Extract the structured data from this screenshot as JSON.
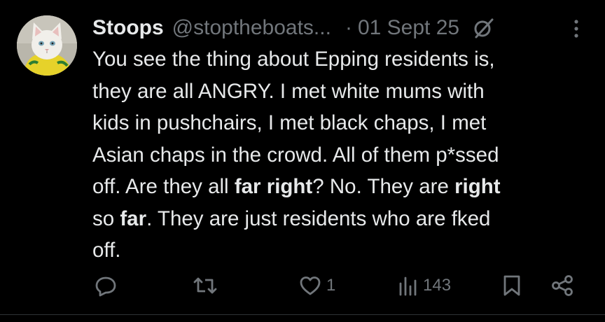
{
  "author": {
    "display_name": "Stoops",
    "handle": "@stoptheboats...",
    "separator": "·",
    "date": "01 Sept 25",
    "avatar_icon": "white-cat-avatar",
    "badge_icon": "grok-icon"
  },
  "tweet": {
    "line1": "You see the thing about Epping residents is,",
    "line2": "they are all ANGRY. I met white mums with",
    "line3": "kids in pushchairs, I met black chaps, I met",
    "line4": "Asian chaps in the crowd. All of them p*ssed",
    "line5_a": "off. Are they all ",
    "line5_b": "far right",
    "line5_c": "? No. They are ",
    "line5_d": "right",
    "line6_a": "so ",
    "line6_b": "far",
    "line6_c": ". They are just residents who are fked",
    "line7": "off."
  },
  "actions": {
    "reply_icon": "reply-icon",
    "repost_icon": "repost-icon",
    "like_icon": "heart-icon",
    "like_count": "1",
    "views_icon": "views-icon",
    "views_count": "143",
    "bookmark_icon": "bookmark-icon",
    "share_icon": "share-icon",
    "more_icon": "more-vertical-icon"
  },
  "colors": {
    "background": "#000000",
    "text": "#e7e9ea",
    "muted": "#71767b",
    "divider": "#2f3336"
  }
}
